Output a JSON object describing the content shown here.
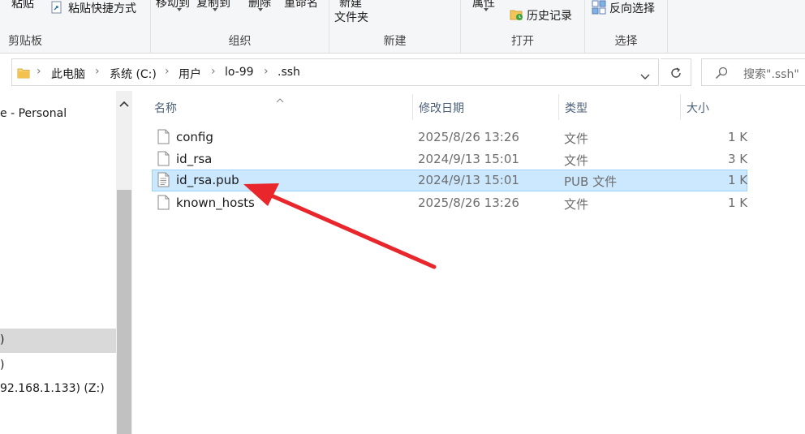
{
  "ribbon": {
    "clipboard": {
      "paste": "粘贴",
      "paste_shortcut": "粘贴快捷方式",
      "label": "剪贴板"
    },
    "organize": {
      "move_to": "移动到",
      "copy_to": "复制到",
      "delete": "删除",
      "rename": "重命名",
      "label": "组织"
    },
    "new": {
      "new_folder_line1": "新建",
      "new_folder_line2": "文件夹",
      "label": "新建"
    },
    "open": {
      "properties": "属性",
      "history": "历史记录",
      "label": "打开"
    },
    "select": {
      "invert": "反向选择",
      "label": "选择"
    }
  },
  "breadcrumb": [
    "此电脑",
    "系统 (C:)",
    "用户",
    "lo-99",
    ".ssh"
  ],
  "search": {
    "placeholder": "搜索\".ssh\""
  },
  "nav": {
    "items": [
      {
        "label": "e - Personal",
        "selected": false
      },
      {
        "label": ")",
        "selected": true
      },
      {
        "label": ")",
        "selected": false
      },
      {
        "label": "92.168.1.133) (Z:)",
        "selected": false
      }
    ]
  },
  "columns": {
    "name": "名称",
    "date": "修改日期",
    "type": "类型",
    "size": "大小"
  },
  "files": [
    {
      "name": "config",
      "date": "2025/8/26 13:26",
      "type": "文件",
      "size": "1 K",
      "selected": false
    },
    {
      "name": "id_rsa",
      "date": "2024/9/13 15:01",
      "type": "文件",
      "size": "3 K",
      "selected": false
    },
    {
      "name": "id_rsa.pub",
      "date": "2024/9/13 15:01",
      "type": "PUB 文件",
      "size": "1 K",
      "selected": true
    },
    {
      "name": "known_hosts",
      "date": "2025/8/26 13:26",
      "type": "文件",
      "size": "1 K",
      "selected": false
    }
  ],
  "colors": {
    "selection_bg": "#cce8ff",
    "selection_border": "#99d1ff",
    "annotation_arrow": "#e8262b"
  },
  "icons": [
    "paste-shortcut-icon",
    "history-icon",
    "invert-selection-icon",
    "folder-icon",
    "chevron-down-icon",
    "refresh-icon",
    "search-icon",
    "scroll-up-icon",
    "file-icon",
    "text-file-icon",
    "sort-ascending-icon",
    "annotation-arrow"
  ]
}
